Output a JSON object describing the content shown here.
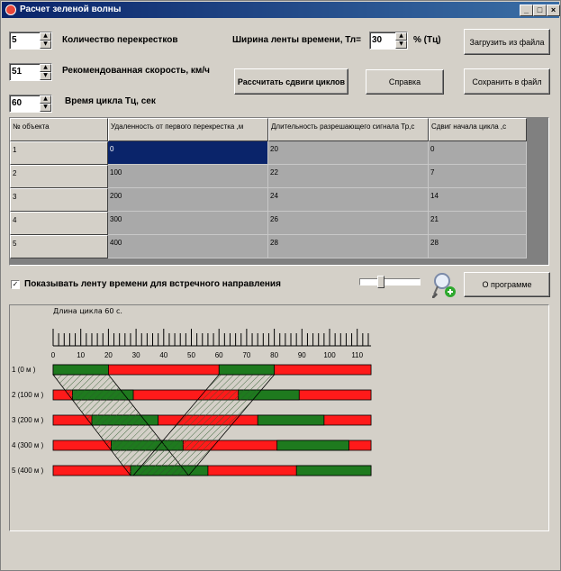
{
  "window": {
    "title": "Расчет зеленой волны",
    "min": "_",
    "max": "□",
    "close": "×"
  },
  "controls": {
    "intersections_value": "5",
    "intersections_label": "Количество перекрестков",
    "speed_value": "51",
    "speed_label": "Рекомендованная скорость, км/ч",
    "cycle_value": "60",
    "cycle_label": "Время цикла Тц, сек",
    "band_label": "Ширина ленты времени, Тл=",
    "band_value": "30",
    "band_unit": "% (Тц)"
  },
  "buttons": {
    "load": "Загрузить из файла",
    "calc": "Рассчитать сдвиги циклов",
    "help": "Справка",
    "save": "Сохранить в файл",
    "about": "О программе"
  },
  "table": {
    "headers": [
      "№ объекта",
      "Удаленность от первого перекрестка ,м",
      "Длительность разрешающего сигнала Тр,с",
      "Сдвиг начала цикла ,с"
    ],
    "rows": [
      [
        "1",
        "0",
        "20",
        "0"
      ],
      [
        "2",
        "100",
        "22",
        "7"
      ],
      [
        "3",
        "200",
        "24",
        "14"
      ],
      [
        "4",
        "300",
        "26",
        "21"
      ],
      [
        "5",
        "400",
        "28",
        "28"
      ]
    ]
  },
  "options": {
    "show_reverse_label": "Показывать ленту времени для встречного направления",
    "show_reverse_checked": true,
    "zoom_icon": "magnifier-plus-icon"
  },
  "chart_data": {
    "type": "timeline",
    "caption": "Длина цикла 60 с.",
    "x_ticks": [
      0,
      10,
      20,
      30,
      40,
      50,
      60,
      70,
      80,
      90,
      100,
      110
    ],
    "xlim": [
      0,
      115
    ],
    "row_labels": [
      "1 (0 м )",
      "2 (100 м )",
      "3 (200 м )",
      "4 (300 м )",
      "5 (400 м )"
    ],
    "cycle": 60,
    "green": [
      20,
      22,
      24,
      26,
      28
    ],
    "offset": [
      0,
      7,
      14,
      21,
      28
    ],
    "colors": {
      "green": "#1e7a1e",
      "red": "#ff1a1a"
    }
  }
}
